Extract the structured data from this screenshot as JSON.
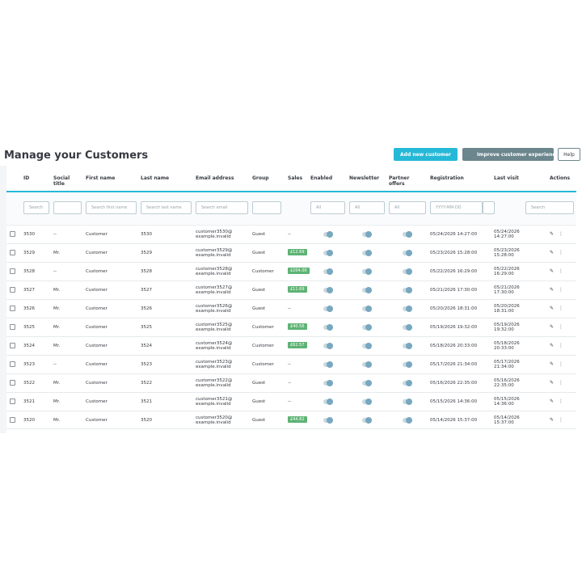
{
  "page": {
    "title": "Manage your Customers",
    "buttons": {
      "add": "Add new customer",
      "improve": "Improve customer experience",
      "help": "Help"
    }
  },
  "colors": {
    "accent": "#25b9d7",
    "secondary": "#6c868e",
    "sales_badge": "#5eb374",
    "toggle": "#78a8c0"
  },
  "table": {
    "headers": [
      "ID",
      "Social title",
      "First name",
      "Last name",
      "Email address",
      "Group",
      "Sales",
      "Enabled",
      "Newsletter",
      "Partner offers",
      "Registration",
      "Last visit",
      "Actions"
    ],
    "filters": {
      "id": "Search",
      "first_name": "Search first name",
      "last_name": "Search last name",
      "email": "Search email",
      "enabled": "All",
      "newsletter": "All",
      "partner_offers": "All",
      "registration": "YYYY-MM-DD",
      "last_visit": "Search"
    },
    "action_icons": {
      "edit": "pencil-icon",
      "more": "kebab-icon"
    },
    "rows": [
      {
        "id": "3530",
        "social": "--",
        "first": "Customer",
        "last": "3530",
        "email1": "customer3530@",
        "email2": "example.invalid",
        "group": "Guest",
        "sales": "--",
        "sales_badge": false,
        "enabled": true,
        "newsletter": true,
        "partner": true,
        "registration": "05/24/2026 14:27:00",
        "last_visit1": "05/24/2026",
        "last_visit2": "14:27:00",
        "edit": "✎",
        "more": "⋮"
      },
      {
        "id": "3529",
        "social": "Mr.",
        "first": "Customer",
        "last": "3529",
        "email1": "customer3529@",
        "email2": "example.invalid",
        "group": "Guest",
        "sales": "£12.69",
        "sales_badge": true,
        "enabled": true,
        "newsletter": true,
        "partner": true,
        "registration": "05/23/2026 15:28:00",
        "last_visit1": "05/23/2026",
        "last_visit2": "15:28:00",
        "edit": "✎",
        "more": "⋮"
      },
      {
        "id": "3528",
        "social": "--",
        "first": "Customer",
        "last": "3528",
        "email1": "customer3528@",
        "email2": "example.invalid",
        "group": "Customer",
        "sales": "£204.00",
        "sales_badge": true,
        "enabled": true,
        "newsletter": true,
        "partner": true,
        "registration": "05/22/2026 16:29:00",
        "last_visit1": "05/22/2026",
        "last_visit2": "16:29:00",
        "edit": "✎",
        "more": "⋮"
      },
      {
        "id": "3527",
        "social": "Mr.",
        "first": "Customer",
        "last": "3527",
        "email1": "customer3527@",
        "email2": "example.invalid",
        "group": "Guest",
        "sales": "£11.69",
        "sales_badge": true,
        "enabled": true,
        "newsletter": true,
        "partner": true,
        "registration": "05/21/2026 17:30:00",
        "last_visit1": "05/21/2026",
        "last_visit2": "17:30:00",
        "edit": "✎",
        "more": "⋮"
      },
      {
        "id": "3526",
        "social": "Mr.",
        "first": "Customer",
        "last": "3526",
        "email1": "customer3526@",
        "email2": "example.invalid",
        "group": "Guest",
        "sales": "--",
        "sales_badge": false,
        "enabled": true,
        "newsletter": true,
        "partner": true,
        "registration": "05/20/2026 18:31:00",
        "last_visit1": "05/20/2026",
        "last_visit2": "18:31:00",
        "edit": "✎",
        "more": "⋮"
      },
      {
        "id": "3525",
        "social": "Mr.",
        "first": "Customer",
        "last": "3525",
        "email1": "customer3525@",
        "email2": "example.invalid",
        "group": "Customer",
        "sales": "£40.56",
        "sales_badge": true,
        "enabled": true,
        "newsletter": true,
        "partner": true,
        "registration": "05/19/2026 19:32:00",
        "last_visit1": "05/19/2026",
        "last_visit2": "19:32:00",
        "edit": "✎",
        "more": "⋮"
      },
      {
        "id": "3524",
        "social": "Mr.",
        "first": "Customer",
        "last": "3524",
        "email1": "customer3524@",
        "email2": "example.invalid",
        "group": "Customer",
        "sales": "£62.57",
        "sales_badge": true,
        "enabled": true,
        "newsletter": true,
        "partner": true,
        "registration": "05/18/2026 20:33:00",
        "last_visit1": "05/18/2026",
        "last_visit2": "20:33:00",
        "edit": "✎",
        "more": "⋮"
      },
      {
        "id": "3523",
        "social": "--",
        "first": "Customer",
        "last": "3523",
        "email1": "customer3523@",
        "email2": "example.invalid",
        "group": "Customer",
        "sales": "--",
        "sales_badge": false,
        "enabled": true,
        "newsletter": true,
        "partner": true,
        "registration": "05/17/2026 21:34:00",
        "last_visit1": "05/17/2026",
        "last_visit2": "21:34:00",
        "edit": "✎",
        "more": "⋮"
      },
      {
        "id": "3522",
        "social": "Mr.",
        "first": "Customer",
        "last": "3522",
        "email1": "customer3522@",
        "email2": "example.invalid",
        "group": "Guest",
        "sales": "--",
        "sales_badge": false,
        "enabled": true,
        "newsletter": true,
        "partner": true,
        "registration": "05/16/2026 22:35:00",
        "last_visit1": "05/16/2026",
        "last_visit2": "22:35:00",
        "edit": "✎",
        "more": "⋮"
      },
      {
        "id": "3521",
        "social": "Mr.",
        "first": "Customer",
        "last": "3521",
        "email1": "customer3521@",
        "email2": "example.invalid",
        "group": "Guest",
        "sales": "--",
        "sales_badge": false,
        "enabled": true,
        "newsletter": true,
        "partner": true,
        "registration": "05/15/2026 14:36:00",
        "last_visit1": "05/15/2026",
        "last_visit2": "14:36:00",
        "edit": "✎",
        "more": "⋮"
      },
      {
        "id": "3520",
        "social": "Mr.",
        "first": "Customer",
        "last": "3520",
        "email1": "customer3520@",
        "email2": "example.invalid",
        "group": "Guest",
        "sales": "£44.82",
        "sales_badge": true,
        "enabled": true,
        "newsletter": true,
        "partner": true,
        "registration": "05/14/2026 15:37:00",
        "last_visit1": "05/14/2026",
        "last_visit2": "15:37:00",
        "edit": "✎",
        "more": "⋮"
      }
    ]
  }
}
